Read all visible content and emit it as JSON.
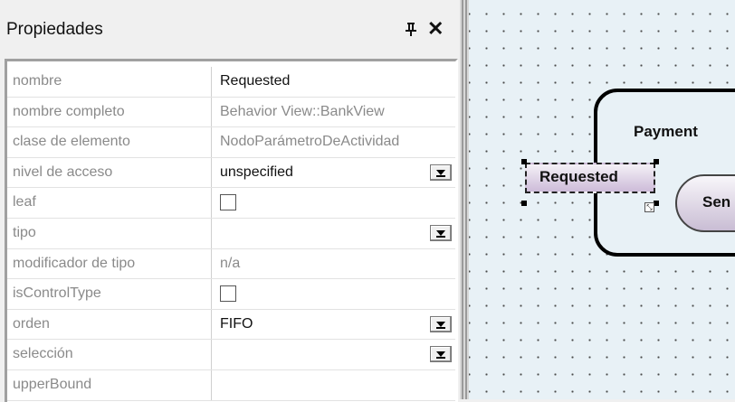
{
  "panel": {
    "title": "Propiedades",
    "pin_glyph": "pin-icon",
    "close_glyph": "✕"
  },
  "properties": [
    {
      "name": "nombre",
      "value": "Requested",
      "dim": false,
      "control": "text"
    },
    {
      "name": "nombre completo",
      "value": "Behavior View::BankView",
      "dim": true,
      "control": "text"
    },
    {
      "name": "clase de elemento",
      "value": "NodoParámetroDeActividad",
      "dim": true,
      "control": "text"
    },
    {
      "name": "nivel de acceso",
      "value": "unspecified",
      "dim": false,
      "control": "dropdown"
    },
    {
      "name": "leaf",
      "value": "",
      "dim": false,
      "control": "checkbox",
      "checked": false
    },
    {
      "name": "tipo",
      "value": "",
      "dim": false,
      "control": "dropdown"
    },
    {
      "name": "modificador de tipo",
      "value": "n/a",
      "dim": true,
      "control": "text"
    },
    {
      "name": "isControlType",
      "value": "",
      "dim": false,
      "control": "checkbox",
      "checked": false
    },
    {
      "name": "orden",
      "value": "FIFO",
      "dim": false,
      "control": "dropdown"
    },
    {
      "name": "selección",
      "value": "",
      "dim": false,
      "control": "dropdown"
    },
    {
      "name": "upperBound",
      "value": "",
      "dim": false,
      "control": "text"
    }
  ],
  "diagram": {
    "activity_label": "Payment",
    "parameter_node_label": "Requested",
    "action_label": "Sen",
    "colors": {
      "canvas_bg": "#e8f1f6",
      "node_fill_top": "#f4f1f7",
      "node_fill_bottom": "#cdbbd9"
    }
  }
}
